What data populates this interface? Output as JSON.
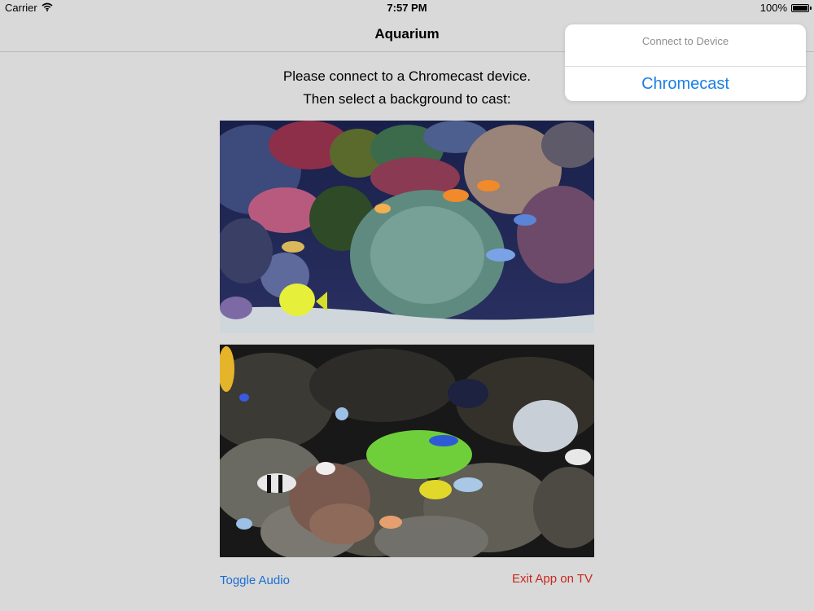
{
  "status_bar": {
    "carrier": "Carrier",
    "time": "7:57 PM",
    "battery": "100%",
    "battery_level": 1.0
  },
  "nav": {
    "title": "Aquarium"
  },
  "instructions": {
    "line1": "Please connect to a Chromecast device.",
    "line2": "Then select a background to cast:"
  },
  "backgrounds": [
    {
      "id": "reef-bright"
    },
    {
      "id": "reef-dark"
    }
  ],
  "actions": {
    "toggle_audio": "Toggle Audio",
    "exit_app": "Exit App on TV"
  },
  "popover": {
    "title": "Connect to Device",
    "options": [
      "Chromecast"
    ]
  },
  "colors": {
    "background": "#d9d9d9",
    "link_blue": "#1a6fd4",
    "exit_red": "#c8281e",
    "popover_blue": "#1a7fe6"
  },
  "icons": {
    "wifi": "wifi-icon",
    "battery": "battery-icon"
  }
}
